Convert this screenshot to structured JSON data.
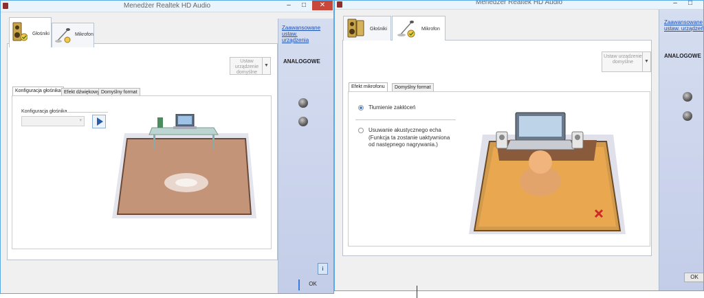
{
  "left_window": {
    "title": "Menedżer Realtek HD Audio",
    "controls": {
      "minimize": "–",
      "maximize": "□",
      "close": "✕"
    },
    "device_tabs": [
      {
        "label": "Głośniki",
        "active": true
      },
      {
        "label": "Mikrofon",
        "active": false
      }
    ],
    "default_device_button": "Ustaw urządzenie domyślne",
    "sub_tabs": [
      {
        "label": "Konfiguracja głośnika",
        "active": true
      },
      {
        "label": "Efekt dźwiękowy",
        "active": false
      },
      {
        "label": "Domyślny format",
        "active": false
      }
    ],
    "speaker_config_label": "Konfiguracja głośnika",
    "advanced_link": "Zaawansowane ustaw. urządzenia",
    "analog_label": "ANALOGOWE",
    "info_button": "i",
    "ok_button": "OK"
  },
  "right_window": {
    "title": "Menedżer Realtek HD Audio",
    "controls": {
      "minimize": "–",
      "maximize": "□"
    },
    "device_tabs": [
      {
        "label": "Głośniki",
        "active": false
      },
      {
        "label": "Mikrofon",
        "active": true
      }
    ],
    "default_device_button": "Ustaw urządzenie domyślne",
    "sub_tabs": [
      {
        "label": "Efekt mikrofonu",
        "active": true
      },
      {
        "label": "Domyślny format",
        "active": false
      }
    ],
    "options": {
      "noise_suppression": {
        "label": "Tłumienie zakłóceń",
        "selected": true
      },
      "echo_cancel": {
        "label": "Usuwanie akustycznego echa",
        "selected": false
      },
      "echo_note": "(Funkcja ta zostanie uaktywniona od następnego nagrywania.)"
    },
    "advanced_link": "Zaawansowane ustaw. urządzeń",
    "analog_label": "ANALOGOWE",
    "ok_button": "OK"
  }
}
